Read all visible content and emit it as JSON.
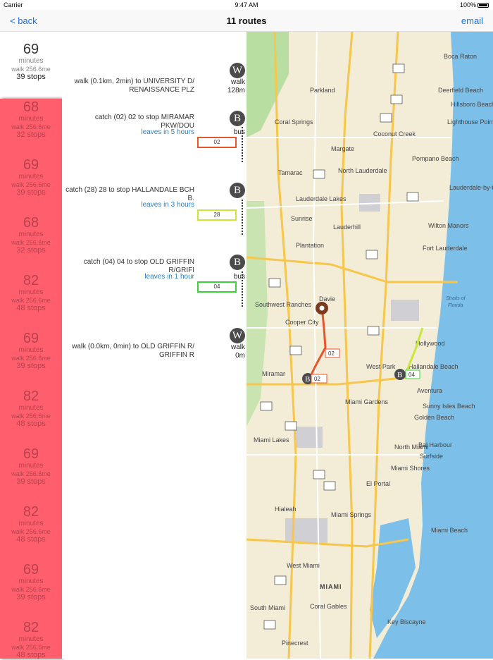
{
  "status": {
    "carrier": "Carrier",
    "time": "9:47 AM",
    "battery": "100%"
  },
  "nav": {
    "back": "< back",
    "title": "11 routes",
    "email": "email"
  },
  "selected_route": {
    "minutes": "69",
    "unit": "minutes",
    "walk": "walk 256.6me",
    "stops": "39 stops"
  },
  "routes": [
    {
      "minutes": "68",
      "unit": "minutes",
      "walk": "walk 256.6me",
      "stops": "32 stops"
    },
    {
      "minutes": "69",
      "unit": "minutes",
      "walk": "walk 256.6me",
      "stops": "39 stops"
    },
    {
      "minutes": "68",
      "unit": "minutes",
      "walk": "walk 256.6me",
      "stops": "32 stops"
    },
    {
      "minutes": "82",
      "unit": "minutes",
      "walk": "walk 256.6me",
      "stops": "48 stops"
    },
    {
      "minutes": "69",
      "unit": "minutes",
      "walk": "walk 256.6me",
      "stops": "39 stops"
    },
    {
      "minutes": "82",
      "unit": "minutes",
      "walk": "walk 256.6me",
      "stops": "48 stops"
    },
    {
      "minutes": "69",
      "unit": "minutes",
      "walk": "walk 256.6me",
      "stops": "39 stops"
    },
    {
      "minutes": "82",
      "unit": "minutes",
      "walk": "walk 256.6me",
      "stops": "48 stops"
    },
    {
      "minutes": "69",
      "unit": "minutes",
      "walk": "walk 256.6me",
      "stops": "39 stops"
    },
    {
      "minutes": "82",
      "unit": "minutes",
      "walk": "walk 256.6me",
      "stops": "48 stops"
    }
  ],
  "steps": [
    {
      "badge": "W",
      "text": "walk (0.1km, 2min) to UNIVERSITY D/ RENAISSANCE PLZ",
      "mode": "walk",
      "distance": "128m"
    },
    {
      "badge": "B",
      "text": "catch (02) 02  to stop MIRAMAR PKW/DOU",
      "leaves": "leaves in  5 hours",
      "mode": "bus",
      "route": "02",
      "color": "#e8552a"
    },
    {
      "badge": "B",
      "text": "catch (28) 28  to stop HALLANDALE BCH B.",
      "leaves": "leaves in  3 hours",
      "mode": "",
      "route": "28",
      "color": "#c8e63c"
    },
    {
      "badge": "B",
      "text": "catch (04) 04  to stop OLD GRIFFIN R/GRIFI",
      "leaves": "leaves in  1 hour",
      "mode": "bus",
      "route": "04",
      "color": "#3cd23c"
    },
    {
      "badge": "W",
      "text": "walk (0.0km, 0min) to OLD GRIFFIN R/ GRIFFIN R",
      "mode": "walk",
      "distance": "0m"
    }
  ],
  "map": {
    "cities": [
      "Boca Raton",
      "Parkland",
      "Deerfield Beach",
      "Hillsboro Beach",
      "Coral Springs",
      "Coconut Creek",
      "Lighthouse Point",
      "Margate",
      "Pompano Beach",
      "Tamarac",
      "North Lauderdale",
      "Lauderdale-by-the-Sea",
      "Lauderdale Lakes",
      "Sunrise",
      "Lauderhill",
      "Wilton Manors",
      "Plantation",
      "Fort Lauderdale",
      "Davie",
      "Southwest Ranches",
      "Cooper City",
      "Hollywood",
      "Miramar",
      "West Park",
      "Hallandale Beach",
      "Aventura",
      "Miami Gardens",
      "Sunny Isles Beach",
      "Golden Beach",
      "Miami Lakes",
      "North Miami",
      "Bal Harbour",
      "Miami Shores",
      "Surfside",
      "Hialeah",
      "El Portal",
      "Miami Springs",
      "Miami Beach",
      "West Miami",
      "MIAMI",
      "South Miami",
      "Coral Gables",
      "Key Biscayne",
      "Pinecrest",
      "Straits of Florida"
    ],
    "route_labels": [
      "02",
      "04"
    ],
    "stop_badge": "B"
  }
}
